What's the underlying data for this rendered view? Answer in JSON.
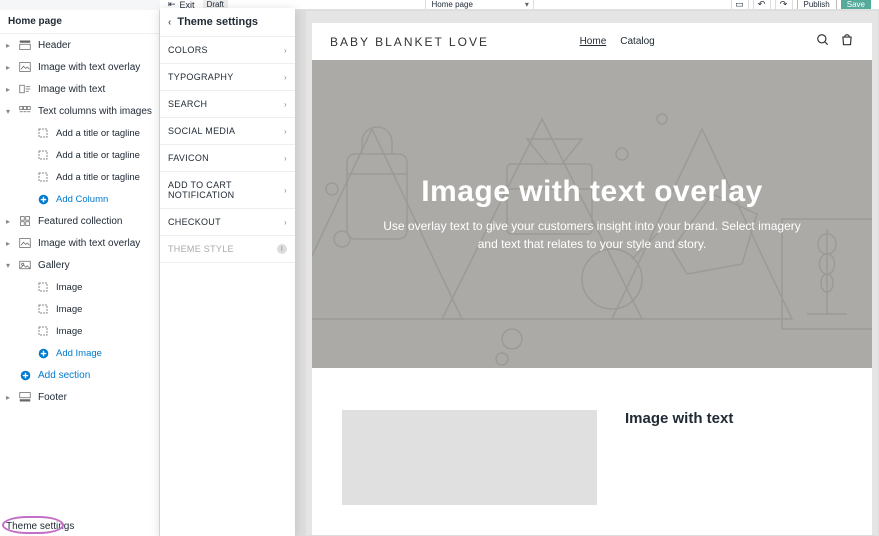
{
  "topbar": {
    "exit": "Exit",
    "draft": "Draft",
    "page_select": "Home page",
    "publish": "Publish",
    "save": "Save"
  },
  "left": {
    "title": "Home page",
    "items": [
      {
        "label": "Header",
        "icon": "header"
      },
      {
        "label": "Image with text overlay",
        "icon": "img-overlay"
      },
      {
        "label": "Image with text",
        "icon": "img-text"
      },
      {
        "label": "Text columns with images",
        "icon": "text-cols",
        "expanded": true
      },
      {
        "label": "Add a title or tagline",
        "sub": true,
        "icon": "block"
      },
      {
        "label": "Add a title or tagline",
        "sub": true,
        "icon": "block"
      },
      {
        "label": "Add a title or tagline",
        "sub": true,
        "icon": "block"
      },
      {
        "label": "Add Column",
        "sub": true,
        "icon": "plus",
        "blue": true
      },
      {
        "label": "Featured collection",
        "icon": "collection"
      },
      {
        "label": "Image with text overlay",
        "icon": "img-overlay"
      },
      {
        "label": "Gallery",
        "icon": "gallery",
        "expanded": true
      },
      {
        "label": "Image",
        "sub": true,
        "icon": "block"
      },
      {
        "label": "Image",
        "sub": true,
        "icon": "block"
      },
      {
        "label": "Image",
        "sub": true,
        "icon": "block"
      },
      {
        "label": "Add Image",
        "sub": true,
        "icon": "plus",
        "blue": true
      },
      {
        "label": "Add section",
        "icon": "plus",
        "blue": true
      },
      {
        "label": "Footer",
        "icon": "footer"
      }
    ],
    "bottom": "Theme settings"
  },
  "settings": {
    "title": "Theme settings",
    "rows": [
      {
        "label": "Colors"
      },
      {
        "label": "Typography"
      },
      {
        "label": "Search"
      },
      {
        "label": "Social media"
      },
      {
        "label": "Favicon"
      },
      {
        "label": "Add to cart notification"
      },
      {
        "label": "Checkout"
      },
      {
        "label": "Theme style",
        "muted": true,
        "info": true
      }
    ]
  },
  "preview": {
    "brand": "BABY BLANKET LOVE",
    "nav_home": "Home",
    "nav_catalog": "Catalog",
    "hero_title": "Image with text overlay",
    "hero_text": "Use overlay text to give your customers insight into your brand. Select imagery and text that relates to your style and story.",
    "below_title": "Image with text"
  }
}
